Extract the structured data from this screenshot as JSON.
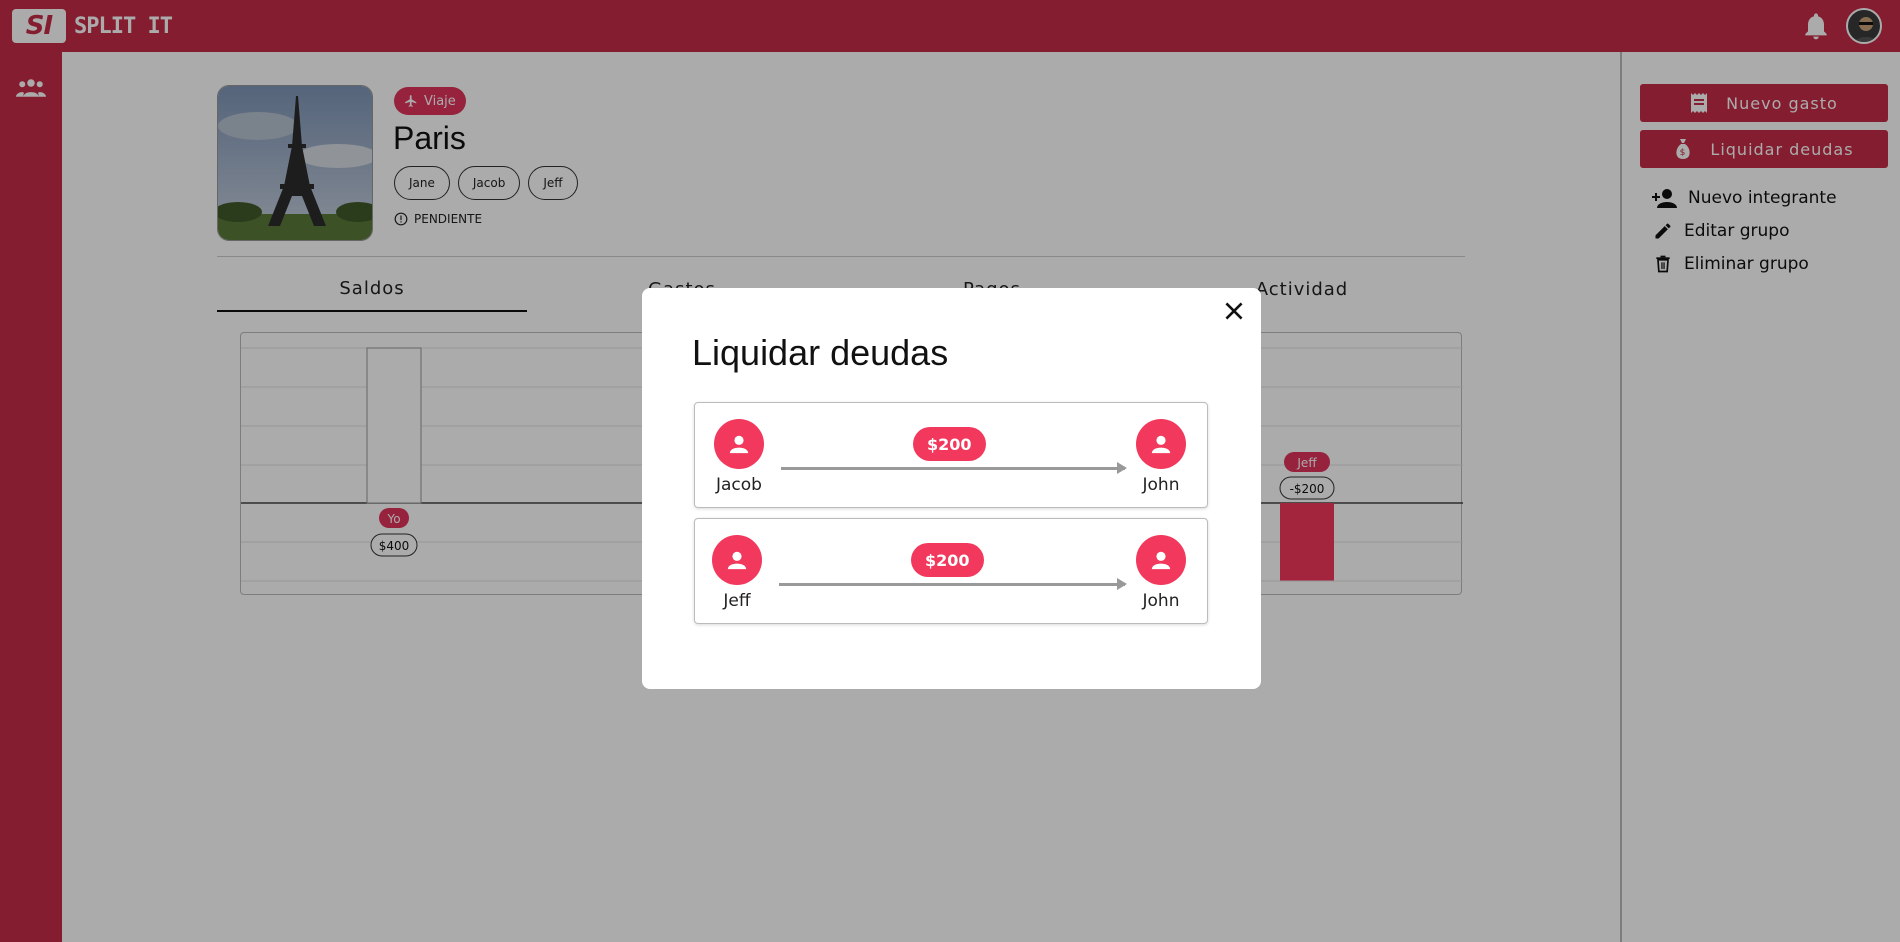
{
  "app": {
    "logo_mark": "SI",
    "logo_text": "SPLIT IT"
  },
  "group": {
    "category": "Viaje",
    "name": "Paris",
    "members": [
      "Jane",
      "Jacob",
      "Jeff"
    ],
    "status": "PENDIENTE"
  },
  "tabs": [
    "Saldos",
    "Gastos",
    "Pagos",
    "Actividad"
  ],
  "active_tab": "Saldos",
  "chart_data": {
    "type": "bar",
    "categories": [
      "Yo",
      "Jeff"
    ],
    "values": [
      400,
      -200
    ],
    "labels": [
      "$400",
      "-$200"
    ],
    "note": "Other members' bars are hidden behind the modal"
  },
  "actions": {
    "new_expense": "Nuevo gasto",
    "settle_debts": "Liquidar deudas",
    "new_member": "Nuevo integrante",
    "edit_group": "Editar grupo",
    "delete_group": "Eliminar grupo"
  },
  "modal": {
    "title": "Liquidar deudas",
    "debts": [
      {
        "from": "Jacob",
        "to": "John",
        "amount": "$200"
      },
      {
        "from": "Jeff",
        "to": "John",
        "amount": "$200"
      }
    ]
  },
  "colors": {
    "brand": "#c72c48",
    "accent": "#f2385c"
  }
}
